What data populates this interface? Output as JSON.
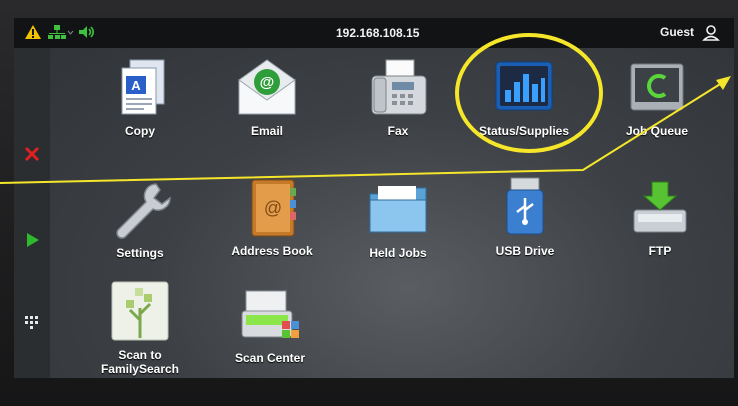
{
  "status_bar": {
    "ip_address": "192.168.108.15",
    "user_label": "Guest",
    "icons": [
      "warning-icon",
      "network-icon",
      "volume-icon",
      "user-icon"
    ]
  },
  "sidebar": {
    "buttons": [
      "cancel-icon",
      "start-icon",
      "keypad-icon"
    ]
  },
  "apps": [
    {
      "label": "Copy",
      "icon": "copy-icon"
    },
    {
      "label": "Email",
      "icon": "email-icon"
    },
    {
      "label": "Fax",
      "icon": "fax-icon"
    },
    {
      "label": "Status/Supplies",
      "icon": "status-supplies-icon"
    },
    {
      "label": "Job Queue",
      "icon": "job-queue-icon"
    },
    {
      "label": "Settings",
      "icon": "settings-icon"
    },
    {
      "label": "Address Book",
      "icon": "address-book-icon"
    },
    {
      "label": "Held Jobs",
      "icon": "held-jobs-icon"
    },
    {
      "label": "USB Drive",
      "icon": "usb-drive-icon"
    },
    {
      "label": "FTP",
      "icon": "ftp-icon"
    },
    {
      "label": "Scan to FamilySearch",
      "label_line1": "Scan to",
      "label_line2": "FamilySearch",
      "icon": "scan-familysearch-icon"
    },
    {
      "label": "Scan Center",
      "icon": "scan-center-icon"
    }
  ],
  "annotation": {
    "circle_color": "#f5e62a",
    "highlighted_app": "Status/Supplies"
  },
  "colors": {
    "warning": "#f2c300",
    "network": "#3ec23e",
    "cancel": "#e02020",
    "start": "#2dbb2d",
    "status_tile": "#1a5fb4"
  }
}
